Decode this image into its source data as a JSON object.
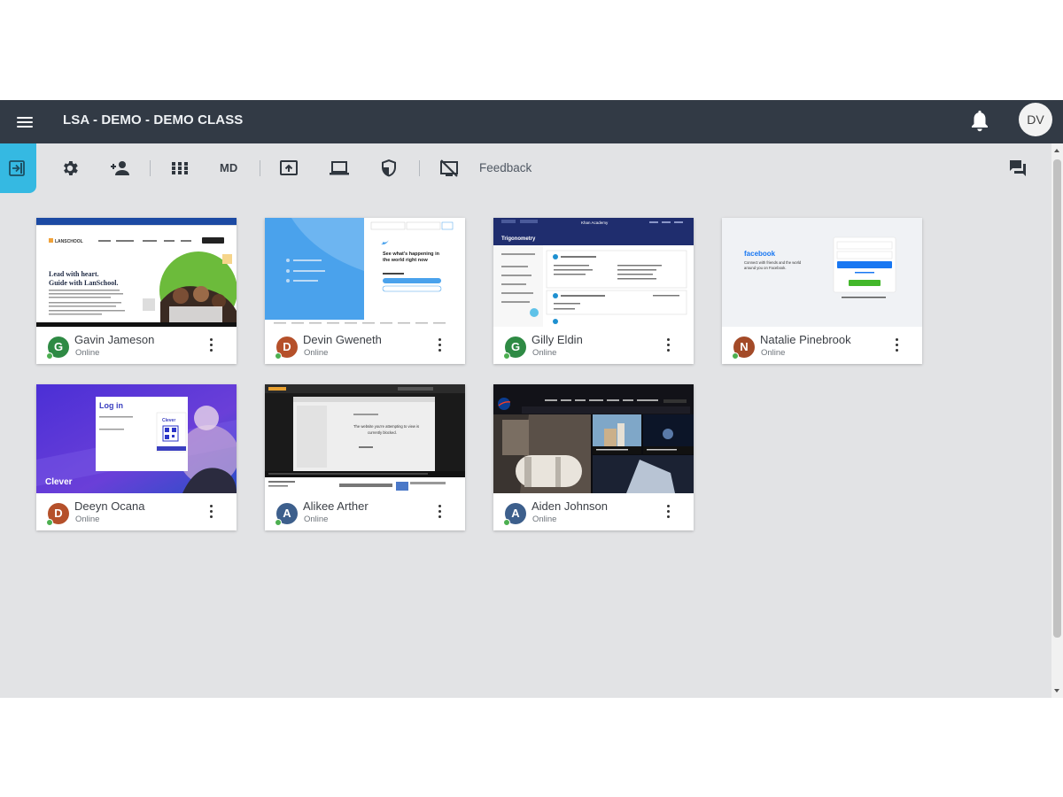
{
  "header": {
    "class_title": "LSA - DEMO - DEMO CLASS",
    "user_initials": "DV"
  },
  "toolbar": {
    "md_label": "MD",
    "feedback_label": "Feedback"
  },
  "colors": {
    "header_bg": "#323a45",
    "accent": "#35b9e2",
    "canvas_bg": "#e2e3e5",
    "online": "#4caf50"
  },
  "students": [
    {
      "name": "Gavin Jameson",
      "initial": "G",
      "status": "Online",
      "color": "#2e8a44",
      "screen": "lanschool"
    },
    {
      "name": "Devin Gweneth",
      "initial": "D",
      "status": "Online",
      "color": "#b5502a",
      "screen": "twitter"
    },
    {
      "name": "Gilly Eldin",
      "initial": "G",
      "status": "Online",
      "color": "#2e8a44",
      "screen": "khan-academy"
    },
    {
      "name": "Natalie Pinebrook",
      "initial": "N",
      "status": "Online",
      "color": "#a34a28",
      "screen": "facebook"
    },
    {
      "name": "Deeyn Ocana",
      "initial": "D",
      "status": "Online",
      "color": "#b5502a",
      "screen": "clever"
    },
    {
      "name": "Alikee Arther",
      "initial": "A",
      "status": "Online",
      "color": "#3d5f8c",
      "screen": "blocked-site"
    },
    {
      "name": "Aiden Johnson",
      "initial": "A",
      "status": "Online",
      "color": "#3d5f8c",
      "screen": "nasa"
    }
  ],
  "thumbnails": {
    "lanschool": {
      "logo": "LANSCHOOL",
      "headline1": "Lead with heart.",
      "headline2": "Guide with LanSchool."
    },
    "twitter": {
      "headline1": "See what's happening in",
      "headline2": "the world right now"
    },
    "khan": {
      "title": "Trigonometry",
      "brand": "Khan Academy"
    },
    "facebook": {
      "logo": "facebook",
      "tagline1": "Connect with friends and the world",
      "tagline2": "around you on Facebook."
    },
    "clever": {
      "login": "Log in",
      "brand": "Clever",
      "badge": "Clever"
    },
    "blocked": {
      "message1": "The website you're attempting to view is",
      "message2": "currently blocked."
    }
  }
}
